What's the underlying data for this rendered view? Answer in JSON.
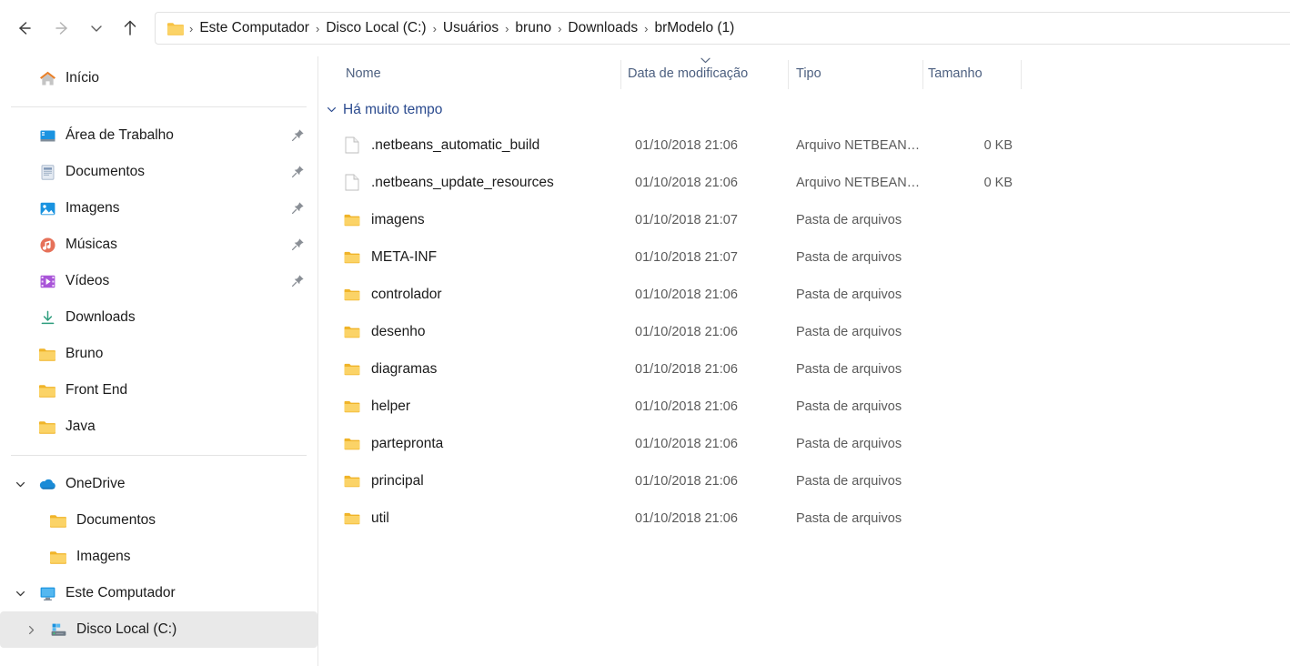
{
  "window": {
    "nav": {
      "back": "Voltar",
      "forward": "Avançar",
      "recent": "Locais recentes",
      "up": "Acima"
    },
    "address": {
      "folder_icon": "folder-icon",
      "separator": "›",
      "crumbs": [
        "Este Computador",
        "Disco Local (C:)",
        "Usuários",
        "bruno",
        "Downloads",
        "brModelo (1)"
      ]
    }
  },
  "sidebar": {
    "home": {
      "label": "Início",
      "icon": "home-icon"
    },
    "quick_access": [
      {
        "label": "Área de Trabalho",
        "icon": "desktop-icon",
        "pinned": true
      },
      {
        "label": "Documentos",
        "icon": "documents-icon",
        "pinned": true
      },
      {
        "label": "Imagens",
        "icon": "pictures-icon",
        "pinned": true
      },
      {
        "label": "Músicas",
        "icon": "music-icon",
        "pinned": true
      },
      {
        "label": "Vídeos",
        "icon": "videos-icon",
        "pinned": true
      },
      {
        "label": "Downloads",
        "icon": "downloads-icon",
        "pinned": false
      },
      {
        "label": "Bruno",
        "icon": "folder-icon",
        "pinned": false
      },
      {
        "label": "Front End",
        "icon": "folder-icon",
        "pinned": false
      },
      {
        "label": "Java",
        "icon": "folder-icon",
        "pinned": false
      }
    ],
    "onedrive": {
      "label": "OneDrive",
      "icon": "cloud-icon",
      "expanded": true,
      "children": [
        {
          "label": "Documentos",
          "icon": "folder-icon"
        },
        {
          "label": "Imagens",
          "icon": "folder-icon"
        }
      ]
    },
    "this_pc": {
      "label": "Este Computador",
      "icon": "monitor-icon",
      "expanded": true,
      "children": [
        {
          "label": "Disco Local (C:)",
          "icon": "drive-icon",
          "selected": true,
          "expanded": false
        }
      ]
    }
  },
  "file_list": {
    "columns": [
      {
        "key": "name",
        "label": "Nome"
      },
      {
        "key": "date",
        "label": "Data de modificação",
        "sorted": true,
        "sort_direction": "asc"
      },
      {
        "key": "type",
        "label": "Tipo"
      },
      {
        "key": "size",
        "label": "Tamanho"
      }
    ],
    "groups": [
      {
        "label": "Há muito tempo",
        "expanded": true,
        "rows": [
          {
            "name": ".netbeans_automatic_build",
            "date": "01/10/2018 21:06",
            "type": "Arquivo NETBEAN…",
            "size": "0 KB",
            "icon": "file-icon"
          },
          {
            "name": ".netbeans_update_resources",
            "date": "01/10/2018 21:06",
            "type": "Arquivo NETBEAN…",
            "size": "0 KB",
            "icon": "file-icon"
          },
          {
            "name": "imagens",
            "date": "01/10/2018 21:07",
            "type": "Pasta de arquivos",
            "size": "",
            "icon": "folder-icon"
          },
          {
            "name": "META-INF",
            "date": "01/10/2018 21:07",
            "type": "Pasta de arquivos",
            "size": "",
            "icon": "folder-icon"
          },
          {
            "name": "controlador",
            "date": "01/10/2018 21:06",
            "type": "Pasta de arquivos",
            "size": "",
            "icon": "folder-icon"
          },
          {
            "name": "desenho",
            "date": "01/10/2018 21:06",
            "type": "Pasta de arquivos",
            "size": "",
            "icon": "folder-icon"
          },
          {
            "name": "diagramas",
            "date": "01/10/2018 21:06",
            "type": "Pasta de arquivos",
            "size": "",
            "icon": "folder-icon"
          },
          {
            "name": "helper",
            "date": "01/10/2018 21:06",
            "type": "Pasta de arquivos",
            "size": "",
            "icon": "folder-icon"
          },
          {
            "name": "partepronta",
            "date": "01/10/2018 21:06",
            "type": "Pasta de arquivos",
            "size": "",
            "icon": "folder-icon"
          },
          {
            "name": "principal",
            "date": "01/10/2018 21:06",
            "type": "Pasta de arquivos",
            "size": "",
            "icon": "folder-icon"
          },
          {
            "name": "util",
            "date": "01/10/2018 21:06",
            "type": "Pasta de arquivos",
            "size": "",
            "icon": "folder-icon"
          }
        ]
      }
    ]
  },
  "colors": {
    "folder_yellow": "#f7c242",
    "accent_blue": "#0a7bd0",
    "group_header_blue": "#2b4b8f",
    "column_header_blue": "#4d6080",
    "selection_gray": "#e9e9e9"
  }
}
